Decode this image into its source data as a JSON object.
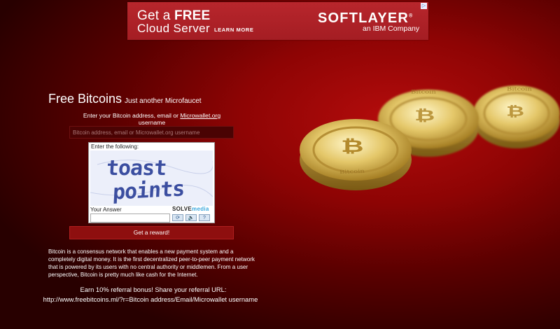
{
  "ad": {
    "line1_prefix": "Get a ",
    "line1_bold": "FREE",
    "line2": "Cloud Server",
    "cta": "LEARN MORE",
    "brand": "SOFTLAYER",
    "brand_mark": "®",
    "tagline": "an IBM Company",
    "adchoices": "▷"
  },
  "header": {
    "title": "Free Bitcoins",
    "subtitle": "Just another Microfaucet"
  },
  "form": {
    "instruction_prefix": "Enter your Bitcoin address, email or ",
    "instruction_link": "Microwallet.org",
    "instruction_suffix": " username",
    "address_placeholder": "Bitcoin address, email or Microwallet.org username",
    "submit_label": "Get a reward!"
  },
  "captcha": {
    "prompt": "Enter the following:",
    "word1": "toast",
    "word2": "points",
    "answer_label": "Your Answer",
    "provider_a": "SOLVE",
    "provider_b": "media",
    "refresh_icon": "⟳",
    "audio_icon": "🔈",
    "help_icon": "?"
  },
  "about": "Bitcoin is a consensus network that enables a new payment system and a completely digital money. It is the first decentralized peer-to-peer payment network that is powered by its users with no central authority or middlemen. From a user perspective, Bitcoin is pretty much like cash for the Internet.",
  "referral": {
    "heading": "Earn 10% referral bonus! Share your referral URL:",
    "url": "http://www.freebitcoins.ml/?r=Bitcoin address/Email/Microwallet username"
  },
  "coins": {
    "label": "Bitcoin",
    "symbol": "₿"
  }
}
